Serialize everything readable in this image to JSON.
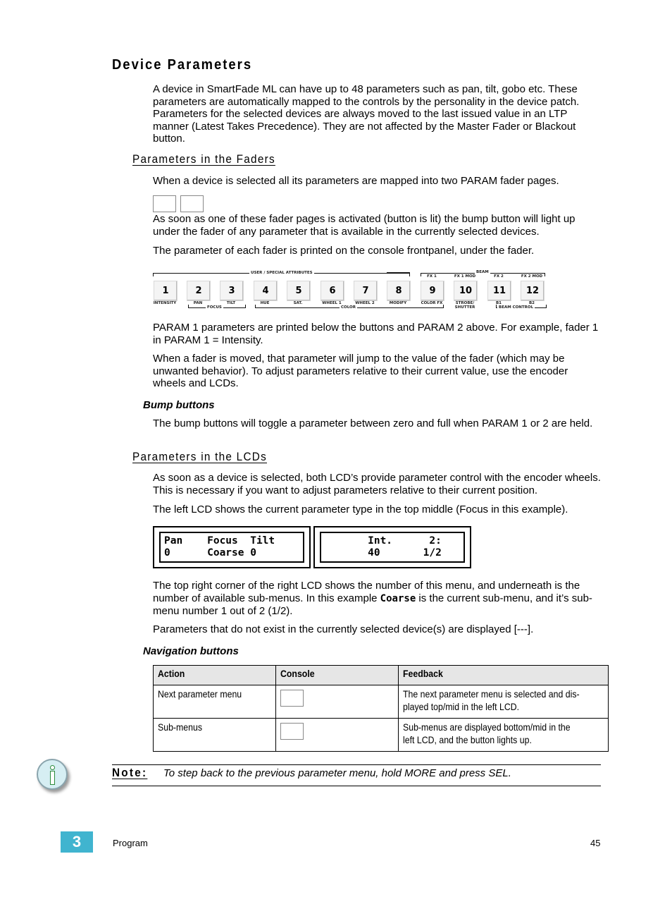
{
  "section": {
    "title": "Device Parameters",
    "intro": "A device in SmartFade ML can have up to 48 parameters such as pan, tilt, gobo etc. These parameters are automatically mapped to the controls by the personality in the device patch. Parameters for the selected devices are always moved to the last issued value in an LTP manner (Latest Takes Precedence). They are not affected by the Master Fader or Blackout button."
  },
  "faders": {
    "title": "Parameters in the Faders",
    "p1": "When a device is selected all its parameters are mapped into two PARAM fader pages.",
    "p2": "As soon as one of these fader pages is activated (button is lit) the bump button will light up under the fader of any parameter that is available in the currently selected devices.",
    "p3": "The parameter of each fader is printed on the console frontpanel, under the fader.",
    "p4": "PARAM 1 parameters are printed below the buttons and PARAM 2 above. For example, fader 1 in PARAM 1 = Intensity.",
    "p5": "When a fader is moved, that parameter will jump to the value of the fader (which may be unwanted behavior). To adjust parameters relative to their current value, use the encoder wheels and LCDs.",
    "bump_title": "Bump buttons",
    "bump_text": "The bump buttons will toggle a parameter between zero and full when PARAM 1 or 2 are held."
  },
  "console_panel": {
    "groups": {
      "user_special": "USER / SPECIAL ATTRIBUTES",
      "beam": "BEAM",
      "focus": "FOCUS",
      "color": "COLOR",
      "beam_control": "BEAM CONTROL"
    },
    "buttons": [
      {
        "num": "1",
        "below": "INTENSITY",
        "above": ""
      },
      {
        "num": "2",
        "below": "PAN",
        "above": ""
      },
      {
        "num": "3",
        "below": "TILT",
        "above": ""
      },
      {
        "num": "4",
        "below": "HUE",
        "above": ""
      },
      {
        "num": "5",
        "below": "SAT.",
        "above": ""
      },
      {
        "num": "6",
        "below": "WHEEL 1",
        "above": ""
      },
      {
        "num": "7",
        "below": "WHEEL 2",
        "above": ""
      },
      {
        "num": "8",
        "below": "MODIFY",
        "above": ""
      },
      {
        "num": "9",
        "below": "COLOR FX",
        "above": "FX 1"
      },
      {
        "num": "10",
        "below": "STROBE/ SHUTTER",
        "above": "FX 1 MOD"
      },
      {
        "num": "11",
        "below": "B1",
        "above": "FX 2"
      },
      {
        "num": "12",
        "below": "B2",
        "above": "FX 2 MOD"
      }
    ]
  },
  "lcds": {
    "title": "Parameters in the LCDs",
    "p1": "As soon as a device is selected, both LCD’s provide parameter control with the encoder wheels. This is necessary if you want to adjust parameters relative to their current position.",
    "p2": "The left LCD shows the current parameter type in the top middle (Focus in this example).",
    "left_lcd": {
      "line1": "Pan    Focus  Tilt",
      "line2": "0      Coarse 0"
    },
    "right_lcd": {
      "line1": "       Int.      2:",
      "line2": "       40       1/2"
    },
    "p3_a": "The top right corner of the right LCD shows the number of this menu, and underneath is the number of available sub-menus. In this example ",
    "p3_code": "Coarse",
    "p3_b": " is the current sub-menu, and it’s sub-menu number 1 out of 2 (1/2).",
    "p4": "Parameters that do not exist in the currently selected device(s) are displayed [---].",
    "nav_title": "Navigation buttons"
  },
  "nav_table": {
    "headers": [
      "Action",
      "Console",
      "Feedback"
    ],
    "rows": [
      {
        "action": "Next parameter menu",
        "feedback_l1": "The next parameter menu is selected and dis-",
        "feedback_l2": "played top/mid in the left LCD."
      },
      {
        "action": "Sub-menus",
        "feedback_l1": "Sub-menus are displayed bottom/mid in the",
        "feedback_l2": "left LCD, and the button lights up."
      }
    ]
  },
  "note": {
    "label": "Note:",
    "text": "To step back to the previous parameter menu, hold MORE and press SEL.",
    "icon": "info-icon"
  },
  "footer": {
    "chapter": "3",
    "title": "Program",
    "page": "45",
    "accent": "#40b4cf"
  }
}
